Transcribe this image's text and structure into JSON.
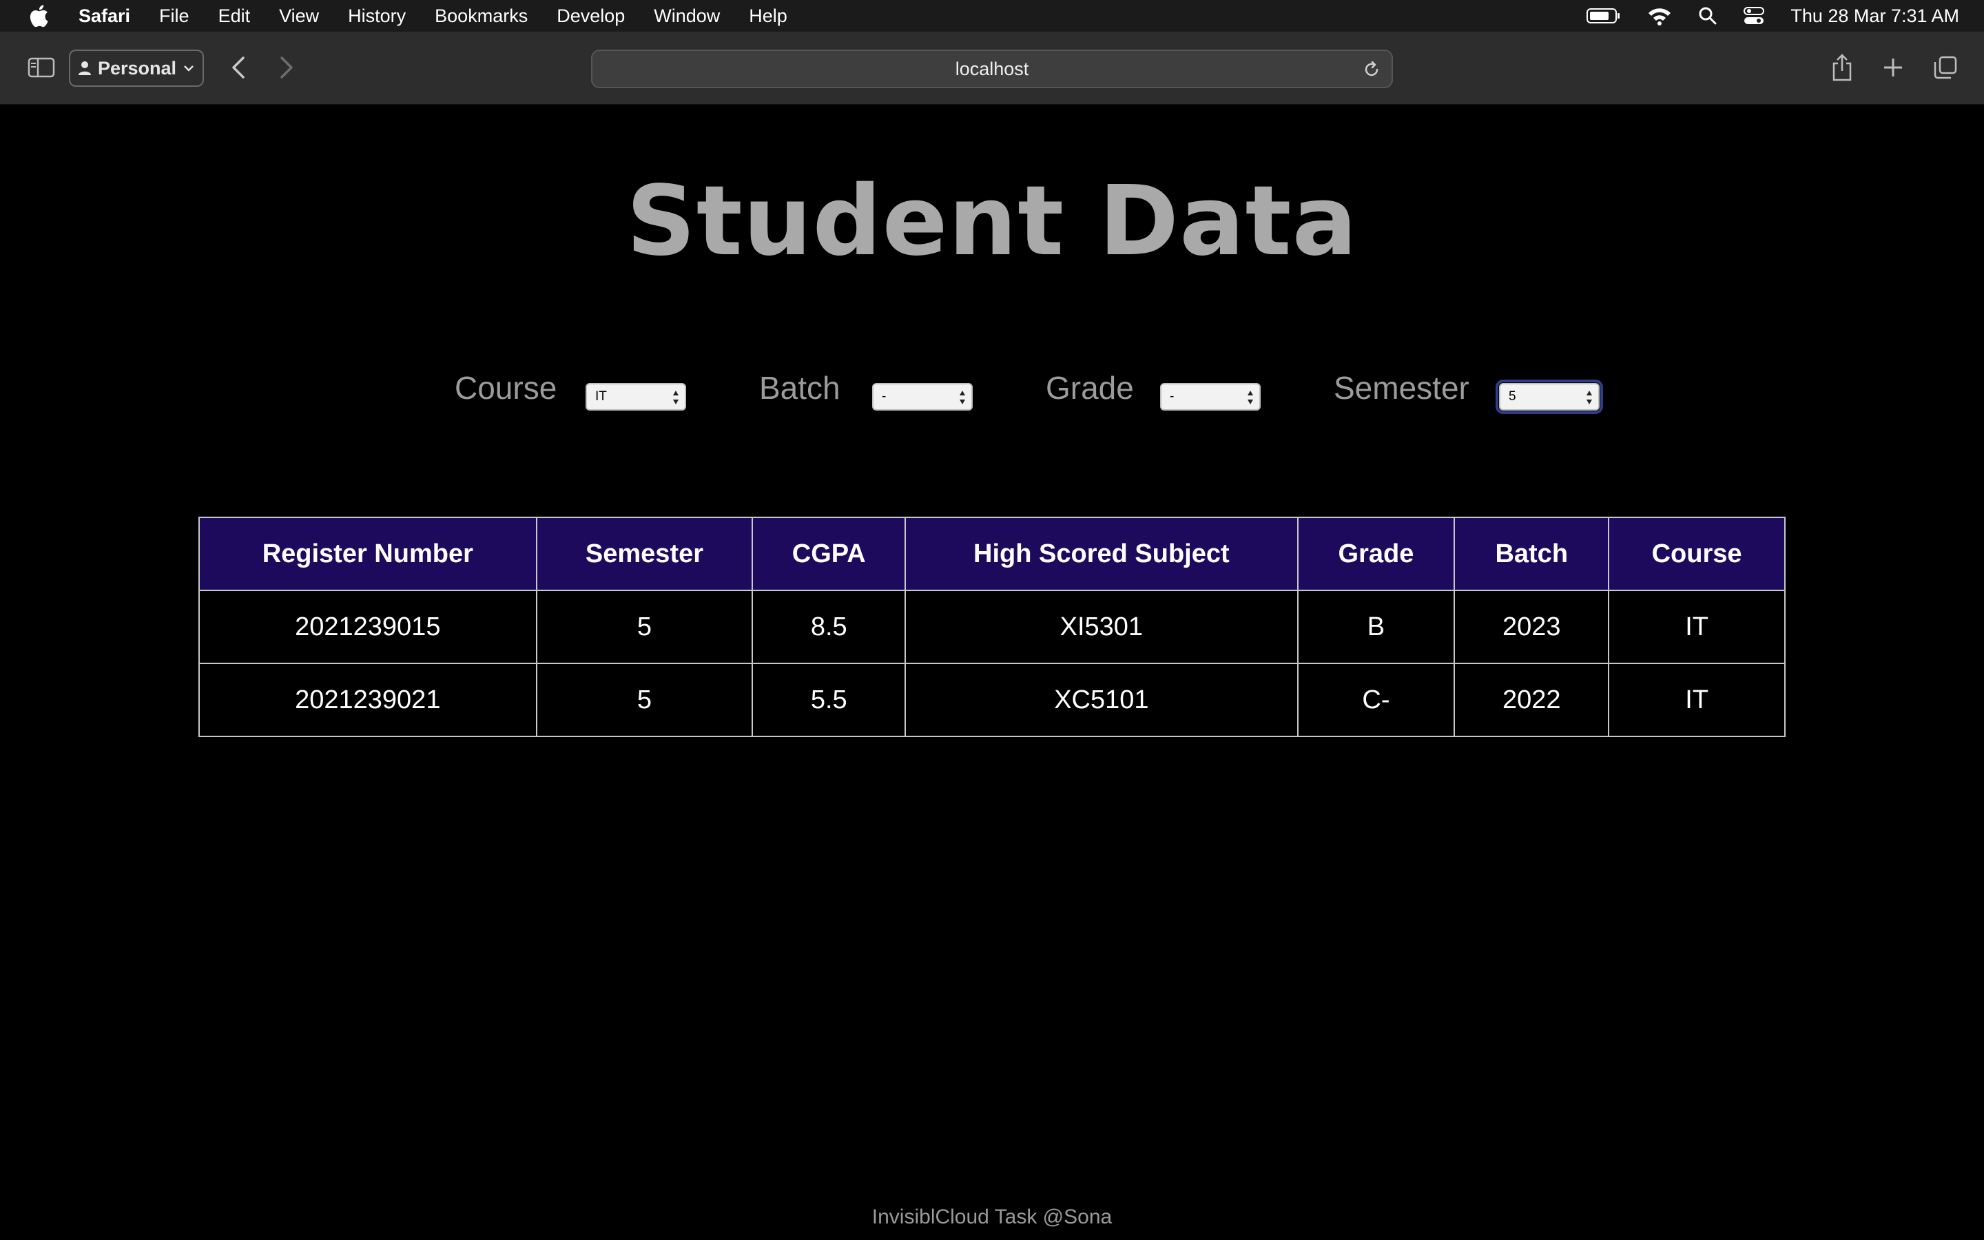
{
  "menubar": {
    "app": "Safari",
    "items": [
      "File",
      "Edit",
      "View",
      "History",
      "Bookmarks",
      "Develop",
      "Window",
      "Help"
    ],
    "clock": "Thu 28 Mar  7:31 AM"
  },
  "toolbar": {
    "profile": "Personal",
    "address": "localhost"
  },
  "page": {
    "title": "Student Data",
    "filters": [
      {
        "label": "Course",
        "value": "IT"
      },
      {
        "label": "Batch",
        "value": "-"
      },
      {
        "label": "Grade",
        "value": "-"
      },
      {
        "label": "Semester",
        "value": "5"
      }
    ],
    "table": {
      "headers": [
        "Register Number",
        "Semester",
        "CGPA",
        "High Scored Subject",
        "Grade",
        "Batch",
        "Course"
      ],
      "rows": [
        [
          "2021239015",
          "5",
          "8.5",
          "XI5301",
          "B",
          "2023",
          "IT"
        ],
        [
          "2021239021",
          "5",
          "5.5",
          "XC5101",
          "C-",
          "2022",
          "IT"
        ]
      ]
    },
    "footer": "InvisiblCloud Task @Sona"
  },
  "colors": {
    "header_bg": "#1e0a5c",
    "title": "#a9a9a9",
    "background": "#000000"
  }
}
